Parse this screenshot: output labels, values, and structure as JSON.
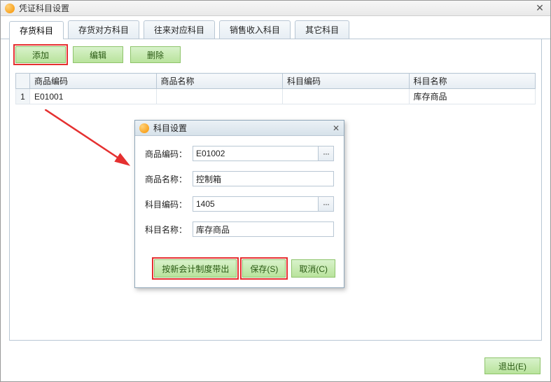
{
  "window": {
    "title": "凭证科目设置"
  },
  "tabs": [
    {
      "label": "存货科目"
    },
    {
      "label": "存货对方科目"
    },
    {
      "label": "往来对应科目"
    },
    {
      "label": "销售收入科目"
    },
    {
      "label": "其它科目"
    }
  ],
  "toolbar": {
    "add": "添加",
    "edit": "编辑",
    "delete": "删除"
  },
  "grid": {
    "headers": {
      "seq": "",
      "code": "商品编码",
      "name": "商品名称",
      "subjcode": "科目编码",
      "subjname": "科目名称"
    },
    "rows": [
      {
        "seq": "1",
        "code": "E01001",
        "name": "",
        "subjcode": "",
        "subjname": "库存商品"
      }
    ]
  },
  "dialog": {
    "title": "科目设置",
    "labels": {
      "pcode": "商品编码：",
      "pname": "商品名称：",
      "scode": "科目编码：",
      "sname": "科目名称："
    },
    "values": {
      "pcode": "E01002",
      "pname": "控制箱",
      "scode": "1405",
      "sname": "库存商品"
    },
    "buttons": {
      "export": "按新会计制度带出",
      "save": "保存(S)",
      "cancel": "取消(C)"
    }
  },
  "footer": {
    "exit": "退出(E)"
  },
  "icons": {
    "ellipsis": "···",
    "close": "✕"
  }
}
